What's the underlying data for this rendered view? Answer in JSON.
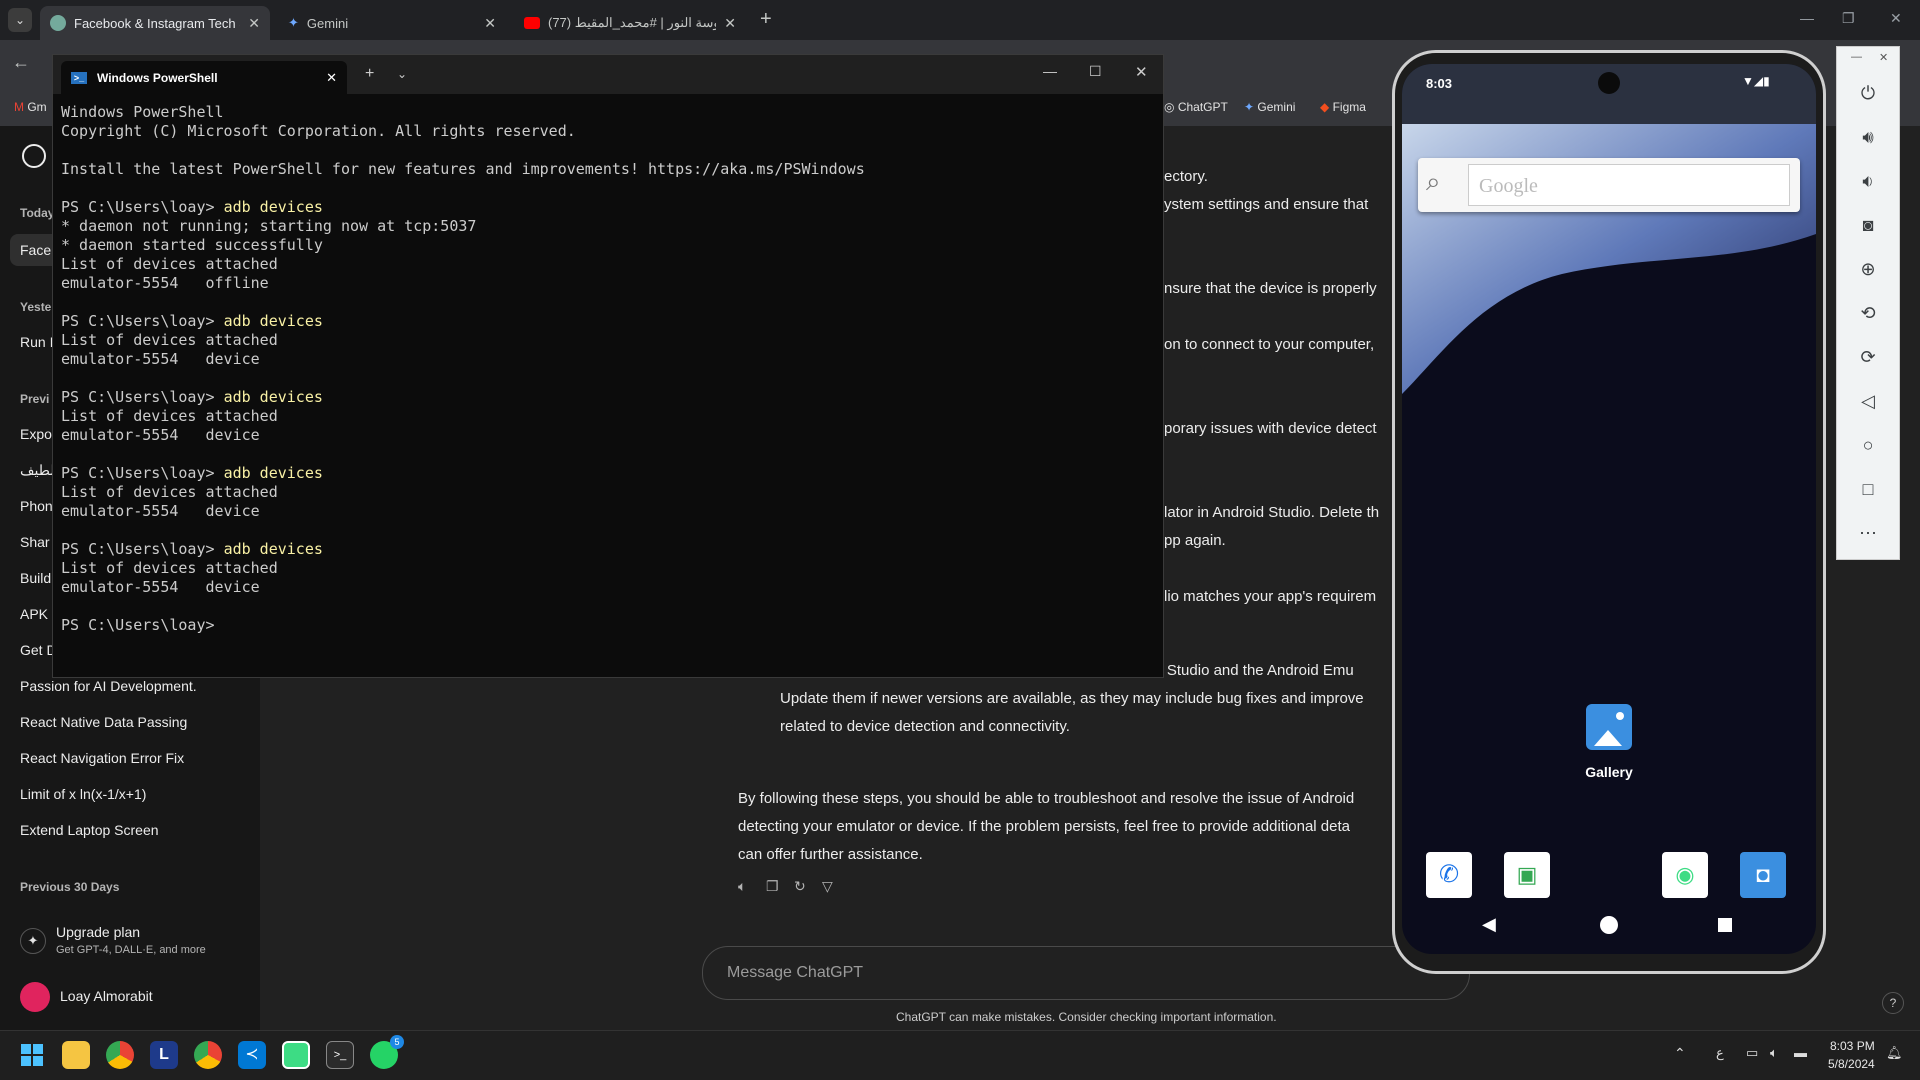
{
  "browser": {
    "tabs": [
      {
        "title": "Facebook & Instagram Tech Sta",
        "active": true
      },
      {
        "title": "Gemini",
        "active": false
      },
      {
        "title": "(77) عروسة النور | #محمد_المقيط",
        "active": false
      }
    ],
    "bookmarks": [
      "Gm",
      "ChatGPT",
      "Gemini",
      "Figma"
    ]
  },
  "chatgpt": {
    "sidebar": {
      "sections": [
        {
          "label": "Today",
          "items": [
            "Facel"
          ]
        },
        {
          "label": "Yester",
          "items": [
            "Run I"
          ]
        },
        {
          "label": "Previ",
          "items": [
            "Expo",
            "لطيف",
            "Phon",
            "Shar",
            "Build",
            "APK",
            "Get D",
            "Passion for AI Development.",
            "React Native Data Passing",
            "React Navigation Error Fix",
            "Limit of x ln(x-1/x+1)",
            "Extend Laptop Screen"
          ]
        },
        {
          "label": "Previous 30 Days",
          "items": []
        }
      ],
      "upgrade_title": "Upgrade plan",
      "upgrade_sub": "Get GPT-4, DALL·E, and more",
      "user_name": "Loay Almorabit"
    },
    "content_fragments": [
      "ectory.",
      "ystem settings and ensure that",
      "nsure that the device is properly",
      "on to connect to your computer,",
      "porary issues with device detect",
      "lator in Android Studio. Delete th",
      "pp again.",
      "lio matches your app's requirem"
    ],
    "bullet_lines": [
      "Make sure that you are using the latest version of Android Studio and the Android Emu",
      "Update them if newer versions are available, as they may include bug fixes and improve",
      "related to device detection and connectivity."
    ],
    "closing_lines": [
      "By following these steps, you should be able to troubleshoot and resolve the issue of Android",
      "detecting your emulator or device. If the problem persists, feel free to provide additional deta",
      "can offer further assistance."
    ],
    "message_placeholder": "Message ChatGPT",
    "disclaimer": "ChatGPT can make mistakes. Consider checking important information."
  },
  "powershell": {
    "tab_title": "Windows PowerShell",
    "lines": [
      {
        "text": "Windows PowerShell",
        "cmd": ""
      },
      {
        "text": "Copyright (C) Microsoft Corporation. All rights reserved.",
        "cmd": ""
      },
      {
        "text": "",
        "cmd": ""
      },
      {
        "text": "Install the latest PowerShell for new features and improvements! https://aka.ms/PSWindows",
        "cmd": ""
      },
      {
        "text": "",
        "cmd": ""
      },
      {
        "text": "PS C:\\Users\\loay> ",
        "cmd": "adb devices"
      },
      {
        "text": "* daemon not running; starting now at tcp:5037",
        "cmd": ""
      },
      {
        "text": "* daemon started successfully",
        "cmd": ""
      },
      {
        "text": "List of devices attached",
        "cmd": ""
      },
      {
        "text": "emulator-5554   offline",
        "cmd": ""
      },
      {
        "text": "",
        "cmd": ""
      },
      {
        "text": "PS C:\\Users\\loay> ",
        "cmd": "adb devices"
      },
      {
        "text": "List of devices attached",
        "cmd": ""
      },
      {
        "text": "emulator-5554   device",
        "cmd": ""
      },
      {
        "text": "",
        "cmd": ""
      },
      {
        "text": "PS C:\\Users\\loay> ",
        "cmd": "adb devices"
      },
      {
        "text": "List of devices attached",
        "cmd": ""
      },
      {
        "text": "emulator-5554   device",
        "cmd": ""
      },
      {
        "text": "",
        "cmd": ""
      },
      {
        "text": "PS C:\\Users\\loay> ",
        "cmd": "adb devices"
      },
      {
        "text": "List of devices attached",
        "cmd": ""
      },
      {
        "text": "emulator-5554   device",
        "cmd": ""
      },
      {
        "text": "",
        "cmd": ""
      },
      {
        "text": "PS C:\\Users\\loay> ",
        "cmd": "adb devices"
      },
      {
        "text": "List of devices attached",
        "cmd": ""
      },
      {
        "text": "emulator-5554   device",
        "cmd": ""
      },
      {
        "text": "",
        "cmd": ""
      },
      {
        "text": "PS C:\\Users\\loay>",
        "cmd": ""
      }
    ]
  },
  "emulator": {
    "status_time": "8:03",
    "search_placeholder": "Google",
    "gallery_label": "Gallery",
    "controls": [
      "power-icon",
      "volume-up-icon",
      "volume-down-icon",
      "camera-icon",
      "zoom-icon",
      "rotate-left-icon",
      "rotate-right-icon",
      "back-icon",
      "home-icon",
      "overview-icon",
      "more-icon"
    ]
  },
  "taskbar": {
    "time": "8:03 PM",
    "date": "5/8/2024",
    "lang": "ع",
    "whatsapp_badge": "5"
  }
}
